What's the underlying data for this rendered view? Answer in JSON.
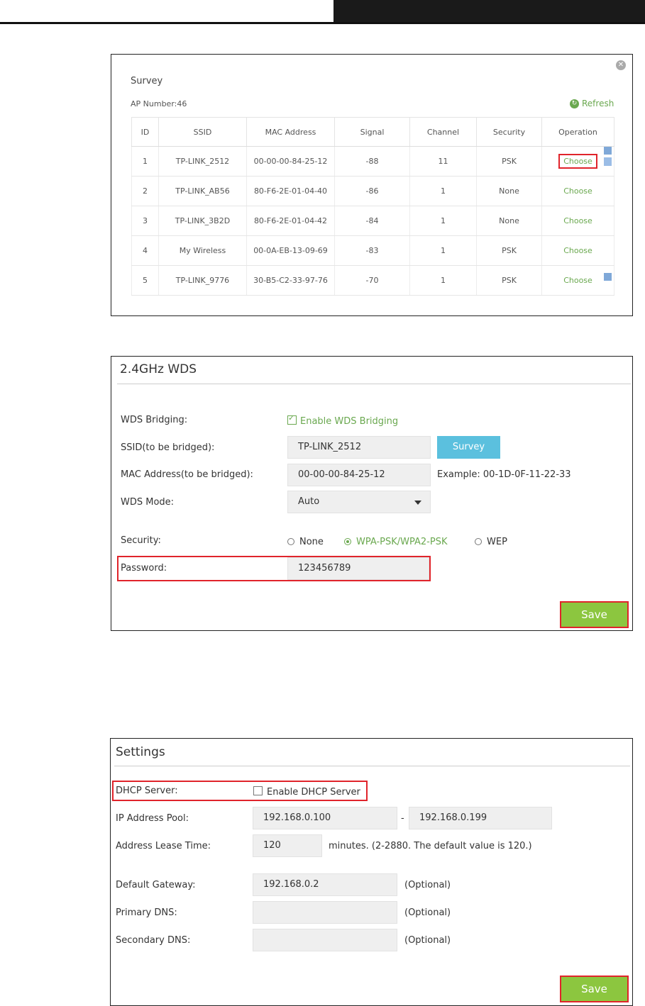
{
  "survey": {
    "title": "Survey",
    "ap_number": "AP Number:46",
    "refresh_label": "Refresh",
    "columns": [
      "ID",
      "SSID",
      "MAC Address",
      "Signal",
      "Channel",
      "Security",
      "Operation"
    ],
    "rows": [
      {
        "id": "1",
        "ssid": "TP-LINK_2512",
        "mac": "00-00-00-84-25-12",
        "signal": "-88",
        "channel": "11",
        "security": "PSK",
        "operation": "Choose"
      },
      {
        "id": "2",
        "ssid": "TP-LINK_AB56",
        "mac": "80-F6-2E-01-04-40",
        "signal": "-86",
        "channel": "1",
        "security": "None",
        "operation": "Choose"
      },
      {
        "id": "3",
        "ssid": "TP-LINK_3B2D",
        "mac": "80-F6-2E-01-04-42",
        "signal": "-84",
        "channel": "1",
        "security": "None",
        "operation": "Choose"
      },
      {
        "id": "4",
        "ssid": "My Wireless",
        "mac": "00-0A-EB-13-09-69",
        "signal": "-83",
        "channel": "1",
        "security": "PSK",
        "operation": "Choose"
      },
      {
        "id": "5",
        "ssid": "TP-LINK_9776",
        "mac": "30-B5-C2-33-97-76",
        "signal": "-70",
        "channel": "1",
        "security": "PSK",
        "operation": "Choose"
      }
    ]
  },
  "wds": {
    "title": "2.4GHz WDS",
    "bridging_label": "WDS Bridging:",
    "bridging_option": "Enable WDS Bridging",
    "ssid_label": "SSID(to be bridged):",
    "ssid_value": "TP-LINK_2512",
    "survey_button": "Survey",
    "mac_label": "MAC Address(to be bridged):",
    "mac_value": "00-00-00-84-25-12",
    "mac_example": "Example: 00-1D-0F-11-22-33",
    "mode_label": "WDS Mode:",
    "mode_value": "Auto",
    "security_label": "Security:",
    "security_options": [
      "None",
      "WPA-PSK/WPA2-PSK",
      "WEP"
    ],
    "password_label": "Password:",
    "password_value": "123456789",
    "save_button": "Save"
  },
  "settings": {
    "title": "Settings",
    "dhcp_label": "DHCP Server:",
    "dhcp_option": "Enable DHCP Server",
    "pool_label": "IP Address Pool:",
    "pool_start": "192.168.0.100",
    "pool_sep": "-",
    "pool_end": "192.168.0.199",
    "lease_label": "Address Lease Time:",
    "lease_value": "120",
    "lease_hint": "minutes. (2-2880. The default value is 120.)",
    "gateway_label": "Default Gateway:",
    "gateway_value": "192.168.0.2",
    "primary_dns_label": "Primary DNS:",
    "primary_dns_value": "",
    "secondary_dns_label": "Secondary DNS:",
    "secondary_dns_value": "",
    "optional_label": "(Optional)",
    "save_button": "Save"
  },
  "colors": {
    "accent_green": "#6aa84f",
    "save_green": "#8cc63f",
    "survey_blue": "#5bc0de",
    "highlight_red": "#e0242b"
  }
}
